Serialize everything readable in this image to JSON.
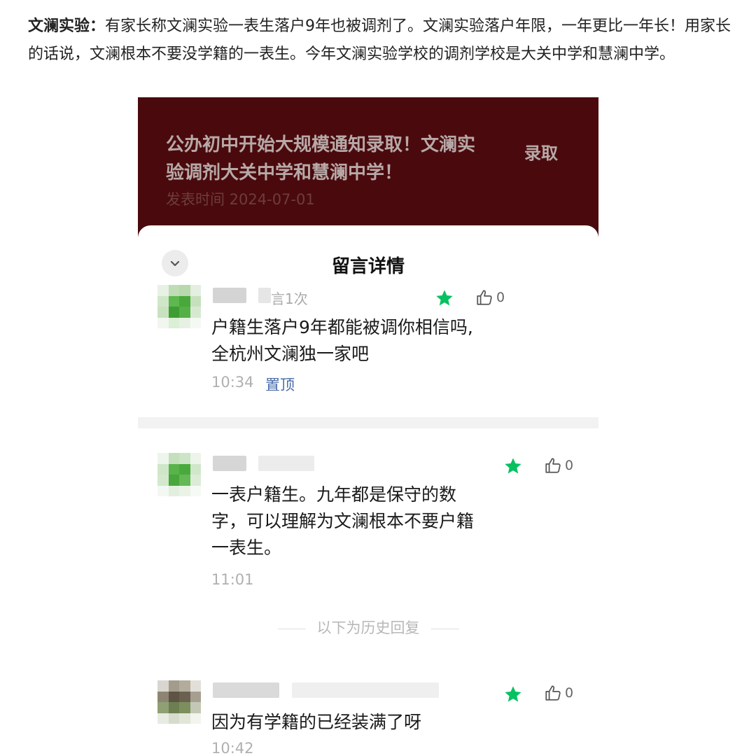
{
  "article": {
    "lead_bold": "文澜实验：",
    "text": "有家长称文澜实验一表生落户9年也被调剂了。文澜实验落户年限，一年更比一年长！用家长的话说，文澜根本不要没学籍的一表生。今年文澜实验学校的调剂学校是大关中学和慧澜中学。"
  },
  "banner": {
    "title": "公办初中开始大规模通知录取！文澜实验调剂大关中学和慧澜中学！",
    "date": "发表时间 2024-07-01",
    "tag": "录取"
  },
  "sheet": {
    "title": "留言详情"
  },
  "comments": [
    {
      "meta": "言1次",
      "likes": "0",
      "text_lines": [
        "户籍生落户9年都能被调你相信吗,",
        "全杭州文澜独一家吧"
      ],
      "time": "10:34",
      "pin_label": "置顶"
    },
    {
      "likes": "0",
      "text_lines": [
        "一表户籍生。九年都是保守的数",
        "字，可以理解为文澜根本不要户籍",
        "一表生。"
      ],
      "time": "11:01"
    },
    {
      "likes": "0",
      "text_lines": [
        "因为有学籍的已经装满了呀"
      ],
      "time": "10:42"
    }
  ],
  "history_label": "以下为历史回复",
  "colors": {
    "banner": "#4a0a0d",
    "star": "#07c160",
    "pin": "#4a6ca8"
  },
  "icons": [
    "chevron-down-icon",
    "star-icon",
    "thumbs-up-icon"
  ]
}
